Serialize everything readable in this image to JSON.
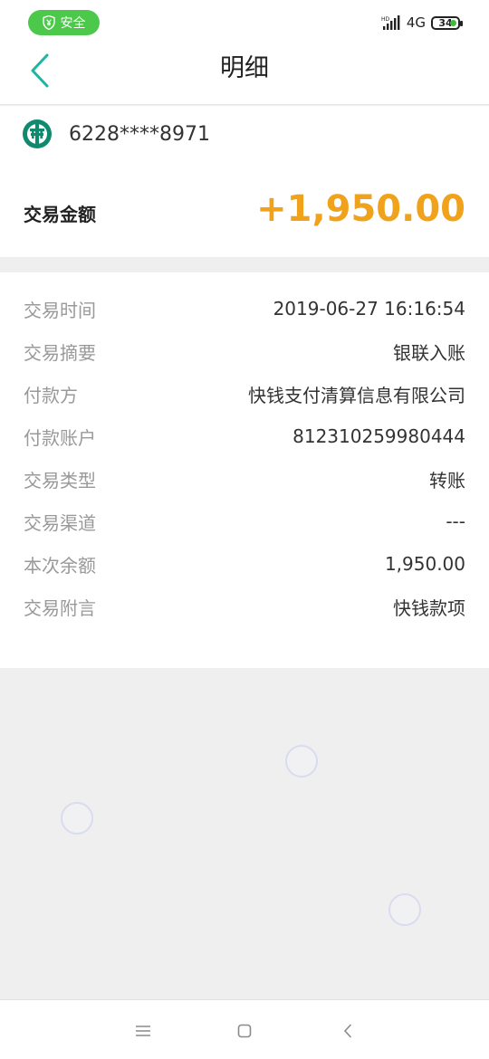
{
  "status_bar": {
    "safe_label": "安全",
    "network": "4G",
    "battery": "34"
  },
  "header": {
    "title": "明细"
  },
  "account": {
    "card_number": "6228****8971",
    "amount_label": "交易金额",
    "amount_value": "+1,950.00"
  },
  "details": [
    {
      "label": "交易时间",
      "value": "2019-06-27 16:16:54"
    },
    {
      "label": "交易摘要",
      "value": "银联入账"
    },
    {
      "label": "付款方",
      "value": "快钱支付清算信息有限公司"
    },
    {
      "label": "付款账户",
      "value": "812310259980444"
    },
    {
      "label": "交易类型",
      "value": "转账"
    },
    {
      "label": "交易渠道",
      "value": "---"
    },
    {
      "label": "本次余额",
      "value": "1,950.00"
    },
    {
      "label": "交易附言",
      "value": "快钱款项"
    }
  ],
  "colors": {
    "accent": "#1fb5a0",
    "amount": "#f0a21b",
    "safe_badge": "#4cc94a",
    "bank_logo": "#0f8a6e"
  }
}
